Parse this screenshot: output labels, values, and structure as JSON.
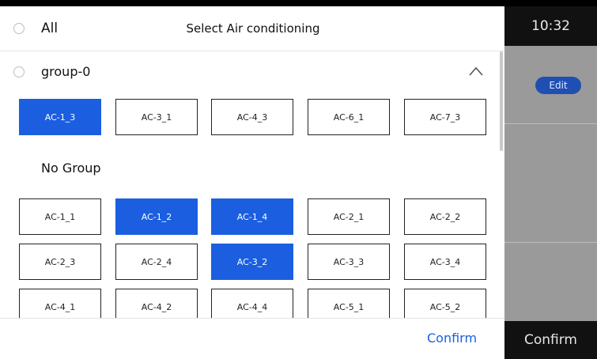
{
  "background": {
    "time": "10:32",
    "edit_label": "Edit",
    "confirm_label": "Confirm"
  },
  "modal": {
    "all_label": "All",
    "title": "Select Air conditioning",
    "group": {
      "label": "group-0",
      "tiles": [
        {
          "label": "AC-1_3",
          "selected": true
        },
        {
          "label": "AC-3_1",
          "selected": false
        },
        {
          "label": "AC-4_3",
          "selected": false
        },
        {
          "label": "AC-6_1",
          "selected": false
        },
        {
          "label": "AC-7_3",
          "selected": false
        }
      ]
    },
    "no_group": {
      "label": "No Group",
      "tiles": [
        {
          "label": "AC-1_1",
          "selected": false
        },
        {
          "label": "AC-1_2",
          "selected": true
        },
        {
          "label": "AC-1_4",
          "selected": true
        },
        {
          "label": "AC-2_1",
          "selected": false
        },
        {
          "label": "AC-2_2",
          "selected": false
        },
        {
          "label": "AC-2_3",
          "selected": false
        },
        {
          "label": "AC-2_4",
          "selected": false
        },
        {
          "label": "AC-3_2",
          "selected": true
        },
        {
          "label": "AC-3_3",
          "selected": false
        },
        {
          "label": "AC-3_4",
          "selected": false
        },
        {
          "label": "AC-4_1",
          "selected": false
        },
        {
          "label": "AC-4_2",
          "selected": false
        },
        {
          "label": "AC-4_4",
          "selected": false
        },
        {
          "label": "AC-5_1",
          "selected": false
        },
        {
          "label": "AC-5_2",
          "selected": false
        }
      ]
    },
    "confirm_label": "Confirm"
  },
  "colors": {
    "accent": "#1b5fe0"
  }
}
